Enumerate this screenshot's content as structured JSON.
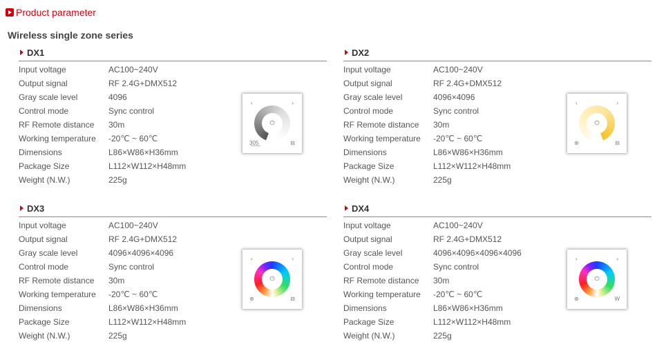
{
  "header": {
    "icon": "play-square-icon",
    "title": "Product parameter"
  },
  "series_title": "Wireless single zone series",
  "products": [
    {
      "name": "DX1",
      "specs": [
        {
          "label": "Input voltage",
          "value": "AC100~240V"
        },
        {
          "label": "Output signal",
          "value": "RF 2.4G+DMX512"
        },
        {
          "label": "Gray scale level",
          "value": "4096"
        },
        {
          "label": "Control mode",
          "value": "Sync control"
        },
        {
          "label": "RF Remote distance",
          "value": "30m"
        },
        {
          "label": "Working temperature",
          "value": "-20℃ ~ 60℃"
        },
        {
          "label": "Dimensions",
          "value": "L86×W86×H36mm"
        },
        {
          "label": "Package Size",
          "value": "L112×W112×H48mm"
        },
        {
          "label": "Weight (N.W.)",
          "value": "225g"
        }
      ],
      "panel": {
        "ring": "dimmer-gray",
        "bottom_left_icon": "cct-icon",
        "bottom_right_icon": "zone-icon"
      }
    },
    {
      "name": "DX2",
      "specs": [
        {
          "label": "Input voltage",
          "value": "AC100~240V"
        },
        {
          "label": "Output signal",
          "value": "RF 2.4G+DMX512"
        },
        {
          "label": "Gray scale level",
          "value": "4096×4096"
        },
        {
          "label": "Control mode",
          "value": "Sync control"
        },
        {
          "label": "RF Remote distance",
          "value": "30m"
        },
        {
          "label": "Working temperature",
          "value": "-20℃ ~ 60℃"
        },
        {
          "label": "Dimensions",
          "value": "L86×W86×H36mm"
        },
        {
          "label": "Package Size",
          "value": "L112×W112×H48mm"
        },
        {
          "label": "Weight (N.W.)",
          "value": "225g"
        }
      ],
      "panel": {
        "ring": "cct-warm",
        "bottom_left_icon": "mode-icon",
        "bottom_right_icon": "zone-icon"
      }
    },
    {
      "name": "DX3",
      "specs": [
        {
          "label": "Input voltage",
          "value": "AC100~240V"
        },
        {
          "label": "Output signal",
          "value": "RF 2.4G+DMX512"
        },
        {
          "label": "Gray scale level",
          "value": "4096×4096×4096"
        },
        {
          "label": "Control mode",
          "value": "Sync control"
        },
        {
          "label": "RF Remote distance",
          "value": "30m"
        },
        {
          "label": "Working temperature",
          "value": "-20℃ ~ 60℃"
        },
        {
          "label": "Dimensions",
          "value": "L86×W86×H36mm"
        },
        {
          "label": "Package Size",
          "value": "L112×W112×H48mm"
        },
        {
          "label": "Weight (N.W.)",
          "value": "225g"
        }
      ],
      "panel": {
        "ring": "rgb",
        "bottom_left_icon": "mode-icon",
        "bottom_right_icon": "zone-icon"
      }
    },
    {
      "name": "DX4",
      "specs": [
        {
          "label": "Input voltage",
          "value": "AC100~240V"
        },
        {
          "label": "Output signal",
          "value": "RF 2.4G+DMX512"
        },
        {
          "label": "Gray scale level",
          "value": "4096×4096×4096×4096"
        },
        {
          "label": "Control mode",
          "value": "Sync control"
        },
        {
          "label": "RF Remote distance",
          "value": "30m"
        },
        {
          "label": "Working temperature",
          "value": "-20℃ ~ 60℃"
        },
        {
          "label": "Dimensions",
          "value": "L86×W86×H36mm"
        },
        {
          "label": "Package Size",
          "value": "L112×W112×H48mm"
        },
        {
          "label": "Weight (N.W.)",
          "value": "225g"
        }
      ],
      "panel": {
        "ring": "rgbw",
        "bottom_left_icon": "mode-icon",
        "bottom_right_label": "W"
      }
    }
  ],
  "panel_glyphs": {
    "prev": "‹",
    "next": "›",
    "power": "⏻",
    "cct": "3̲0̲5̲",
    "zone": "⊟",
    "mode": "⊛",
    "w": "W"
  }
}
